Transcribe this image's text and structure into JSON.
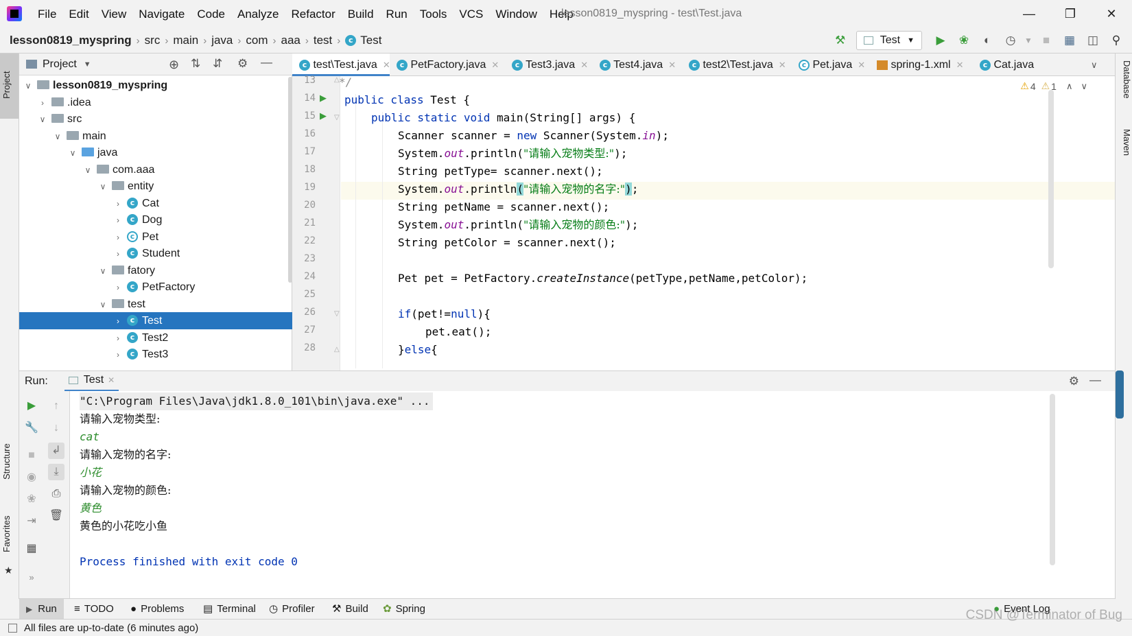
{
  "menu": {
    "items": [
      "File",
      "Edit",
      "View",
      "Navigate",
      "Code",
      "Analyze",
      "Refactor",
      "Build",
      "Run",
      "Tools",
      "VCS",
      "Window",
      "Help"
    ],
    "window_title": "lesson0819_myspring - test\\Test.java"
  },
  "breadcrumb": [
    "lesson0819_myspring",
    "src",
    "main",
    "java",
    "com",
    "aaa",
    "test",
    "Test"
  ],
  "toolbar": {
    "run_config": "Test"
  },
  "left_strip": {
    "project": "Project",
    "structure": "Structure",
    "favorites": "Favorites"
  },
  "right_strip": {
    "database": "Database",
    "maven": "Maven"
  },
  "project_panel": {
    "title": "Project",
    "tree": [
      {
        "label": "lesson0819_myspring",
        "bold": true
      },
      {
        "label": ".idea"
      },
      {
        "label": "src"
      },
      {
        "label": "main"
      },
      {
        "label": "java"
      },
      {
        "label": "com.aaa"
      },
      {
        "label": "entity"
      },
      {
        "label": "Cat"
      },
      {
        "label": "Dog"
      },
      {
        "label": "Pet"
      },
      {
        "label": "Student"
      },
      {
        "label": "fatory"
      },
      {
        "label": "PetFactory"
      },
      {
        "label": "test"
      },
      {
        "label": "Test",
        "selected": true
      },
      {
        "label": "Test2"
      },
      {
        "label": "Test3"
      }
    ]
  },
  "editor_tabs": [
    "test\\Test.java",
    "PetFactory.java",
    "Test3.java",
    "Test4.java",
    "test2\\Test.java",
    "Pet.java",
    "spring-1.xml",
    "Cat.java"
  ],
  "inspections": {
    "warnings": "4",
    "weak_warnings": "1"
  },
  "editor": {
    "line_numbers": [
      "13",
      "14",
      "15",
      "16",
      "17",
      "18",
      "19",
      "20",
      "21",
      "22",
      "23",
      "24",
      "25",
      "26",
      "27",
      "28"
    ],
    "lines": {
      "l13": "*/",
      "l14_kw": "public class ",
      "l14_rest": "Test {",
      "l15_kw": "public static void ",
      "l15_rest": "main(String[] args) {",
      "l16_a": "Scanner scanner = ",
      "l16_kw": "new",
      "l16_b": " Scanner(System.",
      "l16_static": "in",
      "l16_c": ");",
      "l17_a": "System.",
      "l17_static": "out",
      "l17_b": ".println(",
      "l17_str": "\"请输入宠物类型:\"",
      "l17_c": ");",
      "l18": "String petType= scanner.next();",
      "l19_a": "System.",
      "l19_static": "out",
      "l19_b": ".println",
      "l19_p1": "(",
      "l19_str": "\"请输入宠物的名字:\"",
      "l19_p2": ")",
      "l19_c": ";",
      "l20": "String petName = scanner.next();",
      "l21_a": "System.",
      "l21_static": "out",
      "l21_b": ".println(",
      "l21_str": "\"请输入宠物的颜色:\"",
      "l21_c": ");",
      "l22": "String petColor = scanner.next();",
      "l24_a": "Pet pet = PetFactory.",
      "l24_meth": "createInstance",
      "l24_b": "(petType,petName,petColor);",
      "l26_kw": "if",
      "l26_a": "(pet!=",
      "l26_kw2": "null",
      "l26_b": "){",
      "l27": "pet.eat();",
      "l28_a": "}",
      "l28_kw": "else",
      "l28_b": "{"
    }
  },
  "run_panel": {
    "label": "Run:",
    "tab": "Test",
    "console": {
      "cmd": "\"C:\\Program Files\\Java\\jdk1.8.0_101\\bin\\java.exe\" ...",
      "prompt_type": "请输入宠物类型:",
      "input_type": "cat",
      "prompt_name": "请输入宠物的名字:",
      "input_name": "小花",
      "prompt_color": "请输入宠物的颜色:",
      "input_color": "黄色",
      "output": "黄色的小花吃小鱼",
      "exit": "Process finished with exit code 0"
    }
  },
  "bottom_tabs": [
    "Run",
    "TODO",
    "Problems",
    "Terminal",
    "Profiler",
    "Build",
    "Spring"
  ],
  "event_log": "Event Log",
  "status": "All files are up-to-date (6 minutes ago)",
  "watermark": "CSDN @Terminator of Bug",
  "colors": {
    "selection": "#2675bf",
    "keyword": "#0033b3",
    "string": "#067d17",
    "static_field": "#871094",
    "run_green": "#3a9d3a"
  }
}
